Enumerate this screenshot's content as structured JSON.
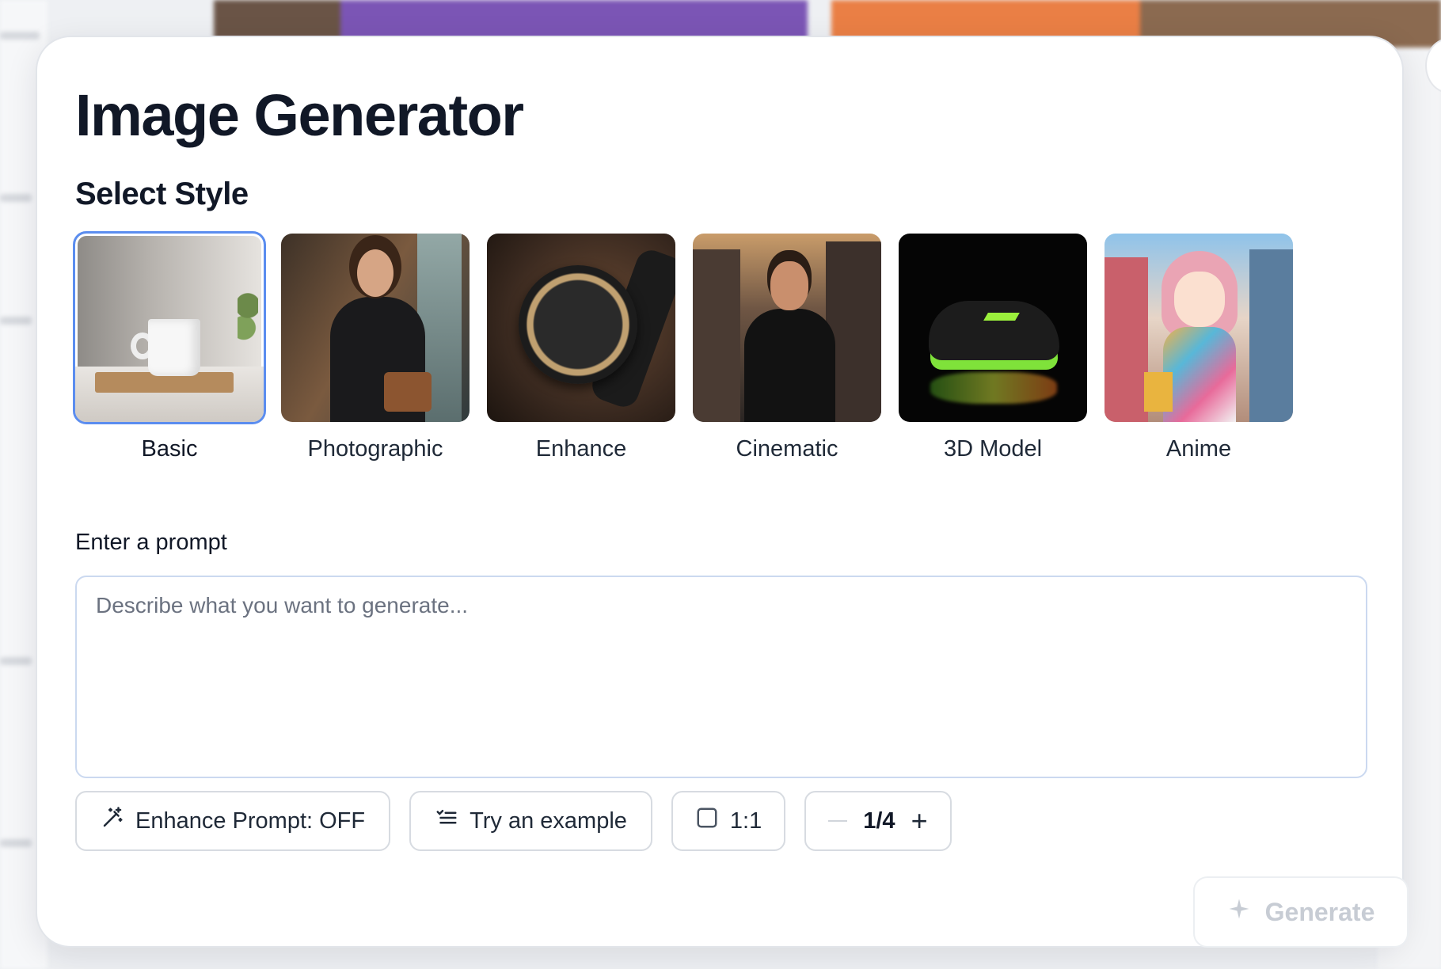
{
  "modal": {
    "title": "Image Generator",
    "select_style_heading": "Select Style"
  },
  "styles": [
    {
      "label": "Basic",
      "selected": true
    },
    {
      "label": "Photographic",
      "selected": false
    },
    {
      "label": "Enhance",
      "selected": false
    },
    {
      "label": "Cinematic",
      "selected": false
    },
    {
      "label": "3D Model",
      "selected": false
    },
    {
      "label": "Anime",
      "selected": false
    }
  ],
  "prompt": {
    "label": "Enter a prompt",
    "value": "",
    "placeholder": "Describe what you want to generate..."
  },
  "controls": {
    "enhance_prompt_label": "Enhance Prompt: OFF",
    "try_example_label": "Try an example",
    "aspect_ratio_label": "1:1",
    "image_count_label": "1/4",
    "plus_symbol": "+"
  },
  "generate": {
    "label": "Generate"
  },
  "colors": {
    "accent": "#5b8def",
    "text_primary": "#111827",
    "disabled_text": "#c7ccd4",
    "border": "#d7dbe1"
  },
  "icons": {
    "enhance": "magic-wand-icon",
    "example": "list-icon",
    "ratio": "square-icon",
    "generate": "sparkle-icon"
  }
}
